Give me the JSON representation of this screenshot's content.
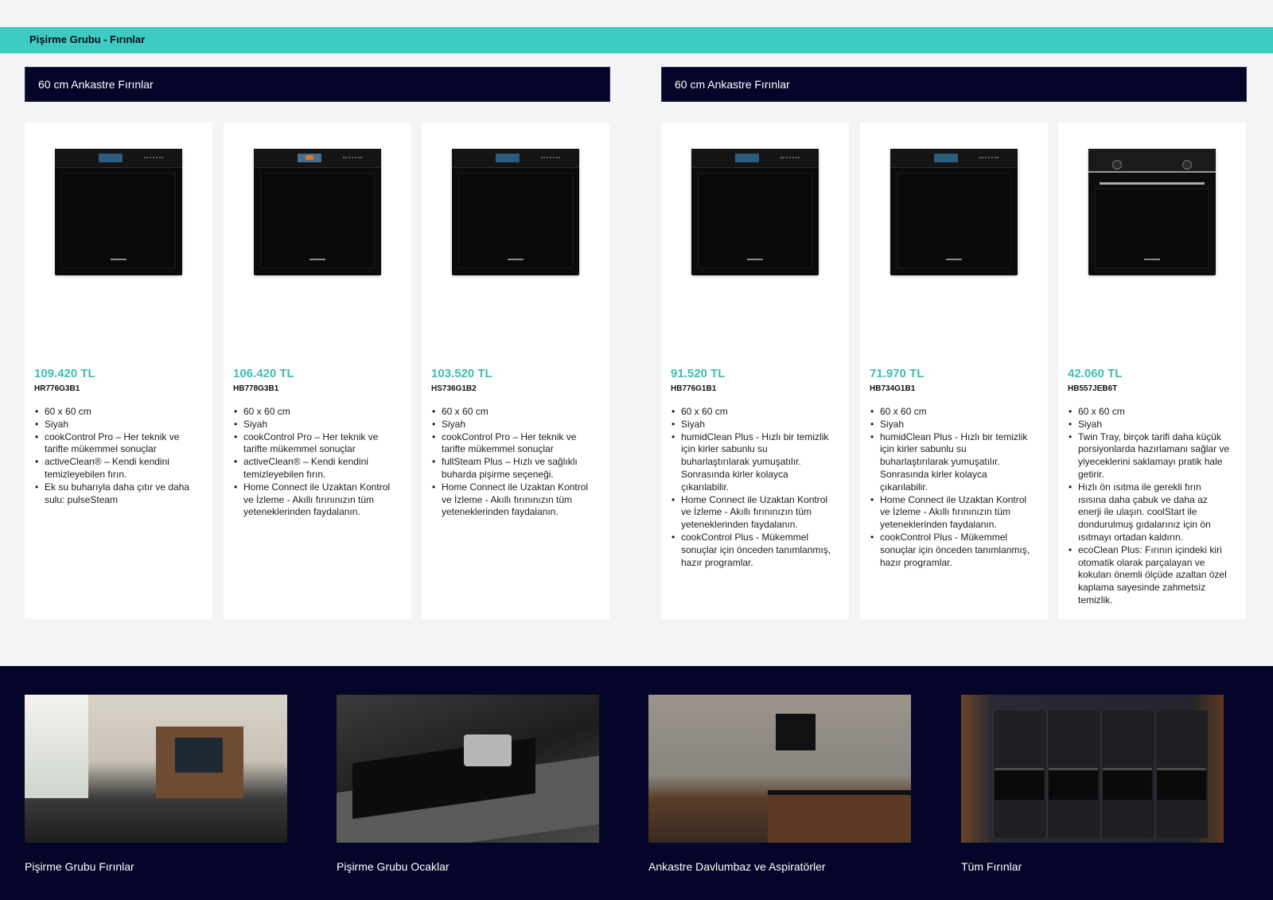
{
  "category": "Pişirme Grubu - Fırınlar",
  "groups": [
    {
      "title": "60 cm Ankastre Fırınlar"
    },
    {
      "title": "60 cm Ankastre Fırınlar"
    }
  ],
  "products": [
    {
      "price": "109.420 TL",
      "model": "HR776G3B1",
      "features": [
        "60 x 60 cm",
        "Siyah",
        "cookControl Pro – Her teknik ve tarifte mükemmel sonuçlar",
        "activeClean® – Kendi kendini temizleyebilen fırın.",
        "Ek su buharıyla daha çıtır ve daha sulu: pulseSteam"
      ]
    },
    {
      "price": "106.420 TL",
      "model": "HB778G3B1",
      "features": [
        "60 x 60 cm",
        "Siyah",
        "cookControl Pro – Her teknik ve tarifte mükemmel sonuçlar",
        "activeClean® – Kendi kendini temizleyebilen fırın.",
        "Home Connect ile Uzaktan Kontrol ve İzleme - Akıllı fırınınızın tüm yeteneklerinden faydalanın."
      ]
    },
    {
      "price": "103.520 TL",
      "model": "HS736G1B2",
      "features": [
        "60 x 60 cm",
        "Siyah",
        "cookControl Pro – Her teknik ve tarifte mükemmel sonuçlar",
        "fullSteam Plus – Hızlı ve sağlıklı buharda pişirme seçeneği.",
        "Home Connect ile Uzaktan Kontrol ve İzleme - Akıllı fırınınızın tüm yeteneklerinden faydalanın."
      ]
    },
    {
      "price": "91.520 TL",
      "model": "HB776G1B1",
      "features": [
        "60 x 60 cm",
        "Siyah",
        "humidClean Plus - Hızlı bir temizlik için kirler sabunlu su buharlaştırılarak yumuşatılır. Sonrasında kirler kolayca çıkarılabilir.",
        "Home Connect ile Uzaktan Kontrol ve İzleme - Akıllı fırınınızın tüm yeteneklerinden faydalanın.",
        "cookControl Plus - Mükemmel sonuçlar için önceden tanımlanmış, hazır programlar."
      ]
    },
    {
      "price": "71.970 TL",
      "model": "HB734G1B1",
      "features": [
        "60 x 60 cm",
        "Siyah",
        "humidClean Plus - Hızlı bir temizlik için kirler sabunlu su buharlaştırılarak yumuşatılır. Sonrasında kirler kolayca çıkarılabilir.",
        "Home Connect ile Uzaktan Kontrol ve İzleme - Akıllı fırınınızın tüm yeteneklerinden faydalanın.",
        "cookControl Plus - Mükemmel sonuçlar için önceden tanımlanmış, hazır programlar."
      ]
    },
    {
      "price": "42.060 TL",
      "model": "HB557JEB6T",
      "features": [
        "60 x 60 cm",
        "Siyah",
        "Twin Tray, birçok tarifi daha küçük porsiyonlarda hazırlamanı sağlar ve yiyeceklerini saklamayı pratik hale getirir.",
        "Hızlı ön ısıtma ile gerekli fırın ısısına daha çabuk ve daha az enerji ile ulaşın. coolStart ile dondurulmuş gıdalarınız için ön ısıtmayı ortadan kaldırın.",
        "ecoClean Plus: Fırının içindeki kiri otomatik olarak parçalayan ve kokuları önemli ölçüde azaltan özel kaplama sayesinde zahmetsiz temizlik."
      ]
    }
  ],
  "footer_links": [
    {
      "label": "Pişirme Grubu Fırınlar"
    },
    {
      "label": "Pişirme Grubu Ocaklar"
    },
    {
      "label": "Ankastre Davlumbaz ve Aspiratörler"
    },
    {
      "label": "Tüm Fırınlar"
    }
  ],
  "colors": {
    "accent": "#3ecbc1",
    "price": "#3dbdb3",
    "navy": "#05052a",
    "background": "#f4f4f6"
  }
}
